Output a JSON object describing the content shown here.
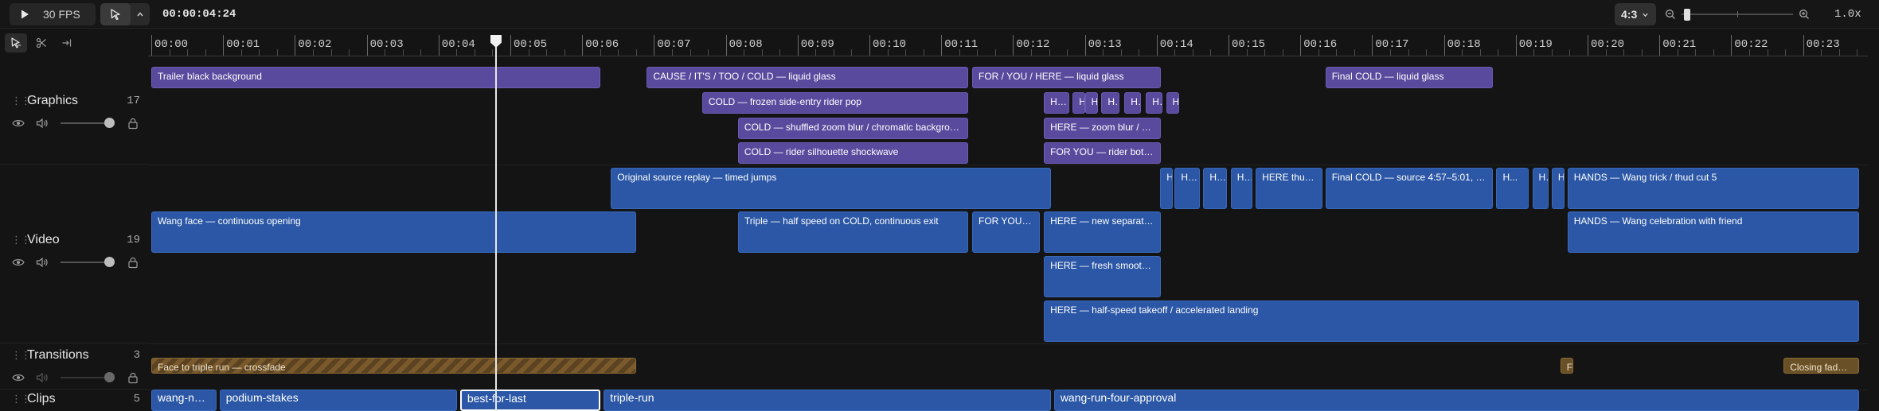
{
  "toolbar": {
    "fps_label": "30 FPS",
    "timecode": "00:00:04:24",
    "aspect_ratio": "4:3",
    "zoom_level": "1.0x",
    "zoom_slider_fraction": 0.02
  },
  "ruler": {
    "labels": [
      "00:00",
      "00:01",
      "00:02",
      "00:03",
      "00:04",
      "00:05",
      "00:06",
      "00:07",
      "00:08",
      "00:09",
      "00:10",
      "00:11",
      "00:12",
      "00:13",
      "00:14",
      "00:15",
      "00:16",
      "00:17",
      "00:18",
      "00:19",
      "00:20",
      "00:21",
      "00:22",
      "00:23"
    ]
  },
  "playhead_seconds": 4.8,
  "tracks": {
    "graphics": {
      "name": "Graphics",
      "count": "17",
      "volume": 1.0
    },
    "video": {
      "name": "Video",
      "count": "19",
      "volume": 1.0
    },
    "transitions": {
      "name": "Transitions",
      "count": "3",
      "volume": 1.0
    },
    "clips": {
      "name": "Clips",
      "count": "5"
    }
  },
  "clips": {
    "graphics": [
      {
        "label": "Trailer black background",
        "start": 0.0,
        "end": 6.27,
        "row": 0
      },
      {
        "label": "CAUSE / IT'S / TOO / COLD — liquid glass",
        "start": 6.9,
        "end": 11.4,
        "row": 0
      },
      {
        "label": "FOR / YOU / HERE — liquid glass",
        "start": 11.43,
        "end": 14.08,
        "row": 0
      },
      {
        "label": "Final COLD — liquid glass",
        "start": 16.35,
        "end": 18.7,
        "row": 0
      },
      {
        "label": "COLD — frozen side-entry rider pop",
        "start": 7.67,
        "end": 11.4,
        "row": 1
      },
      {
        "label": "H...",
        "start": 12.43,
        "end": 12.8,
        "row": 1
      },
      {
        "label": "H",
        "start": 12.83,
        "end": 12.98,
        "row": 1
      },
      {
        "label": "H",
        "start": 13.0,
        "end": 13.2,
        "row": 1
      },
      {
        "label": "H...",
        "start": 13.23,
        "end": 13.5,
        "row": 1
      },
      {
        "label": "H...",
        "start": 13.55,
        "end": 13.8,
        "row": 1
      },
      {
        "label": "H...",
        "start": 13.85,
        "end": 14.1,
        "row": 1
      },
      {
        "label": "H",
        "start": 14.13,
        "end": 14.3,
        "row": 1
      },
      {
        "label": "COLD — shuffled zoom blur / chromatic background",
        "start": 8.17,
        "end": 11.4,
        "row": 2
      },
      {
        "label": "HERE — zoom blur / chromatic background",
        "start": 12.43,
        "end": 14.08,
        "row": 2
      },
      {
        "label": "COLD — rider silhouette shockwave",
        "start": 8.17,
        "end": 11.4,
        "row": 3
      },
      {
        "label": "FOR YOU — rider bottom glow",
        "start": 12.43,
        "end": 14.08,
        "row": 3
      }
    ],
    "video": [
      {
        "label": "Original source replay — timed jumps",
        "start": 6.4,
        "end": 12.55,
        "row": 0
      },
      {
        "label": "H...",
        "start": 14.05,
        "end": 14.23,
        "row": 0
      },
      {
        "label": "H...",
        "start": 14.25,
        "end": 14.62,
        "row": 0
      },
      {
        "label": "H...",
        "start": 14.65,
        "end": 15.0,
        "row": 0
      },
      {
        "label": "H...",
        "start": 15.03,
        "end": 15.35,
        "row": 0
      },
      {
        "label": "HERE thud 5 — fresh take",
        "start": 15.38,
        "end": 16.33,
        "row": 0
      },
      {
        "label": "Final COLD — source 4:57–5:01, fresh entry",
        "start": 16.35,
        "end": 18.7,
        "row": 0
      },
      {
        "label": "H...",
        "start": 18.73,
        "end": 19.2,
        "row": 0
      },
      {
        "label": "H...",
        "start": 19.23,
        "end": 19.48,
        "row": 0
      },
      {
        "label": "H...",
        "start": 19.5,
        "end": 19.7,
        "row": 0
      },
      {
        "label": "HANDS — Wang trick / thud cut 5",
        "start": 19.72,
        "end": 23.8,
        "row": 0
      },
      {
        "label": "Wang face — continuous opening",
        "start": 0.0,
        "end": 6.77,
        "row": 1
      },
      {
        "label": "Triple — half speed on COLD, continuous exit",
        "start": 8.17,
        "end": 11.4,
        "row": 1
      },
      {
        "label": "FOR YOU — half speed",
        "start": 11.43,
        "end": 12.4,
        "row": 1
      },
      {
        "label": "HERE — new separate source",
        "start": 12.43,
        "end": 14.08,
        "row": 1
      },
      {
        "label": "HANDS — Wang celebration with friend",
        "start": 19.72,
        "end": 23.8,
        "row": 1
      },
      {
        "label": "HERE — fresh smoothed landing",
        "start": 12.43,
        "end": 14.08,
        "row": 2
      },
      {
        "label": "HERE — half-speed takeoff / accelerated landing",
        "start": 12.43,
        "end": 23.8,
        "row": 3
      }
    ],
    "transitions": [
      {
        "label": "Face to triple run — crossfade",
        "start": 0.0,
        "end": 6.77,
        "striped": true
      },
      {
        "label": "F...",
        "start": 19.62,
        "end": 19.8,
        "striped": false
      },
      {
        "label": "Closing fade to black",
        "start": 22.73,
        "end": 23.8,
        "striped": false
      }
    ],
    "clips": [
      {
        "label": "wang-name",
        "start": 0.0,
        "end": 0.93,
        "selected": false
      },
      {
        "label": "podium-stakes",
        "start": 0.95,
        "end": 4.28,
        "selected": false
      },
      {
        "label": "best-for-last",
        "start": 4.3,
        "end": 6.27,
        "selected": true
      },
      {
        "label": "triple-run",
        "start": 6.3,
        "end": 12.55,
        "selected": false
      },
      {
        "label": "wang-run-four-approval",
        "start": 12.57,
        "end": 23.8,
        "selected": false
      }
    ]
  }
}
